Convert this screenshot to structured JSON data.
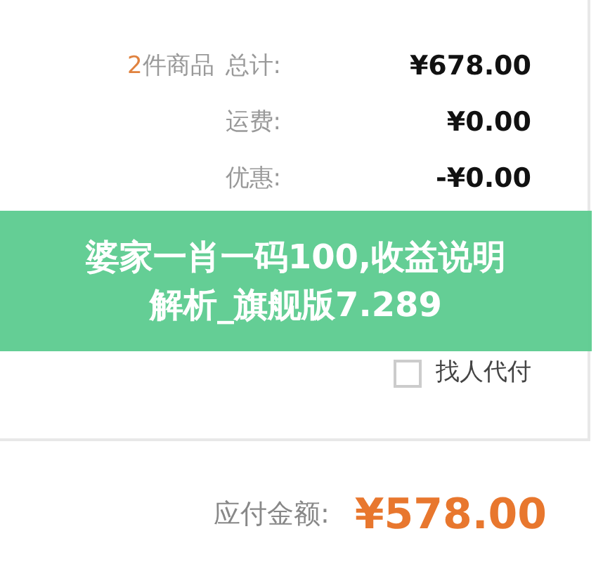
{
  "summary_rows": [
    {
      "count": "2",
      "count_suffix": "件商品",
      "label": "总计:",
      "value": "¥678.00"
    },
    {
      "label": "运费:",
      "value": "¥0.00"
    },
    {
      "label": "优惠:",
      "value": "-¥0.00"
    }
  ],
  "banner": {
    "title": "婆家一肖一码100,收益说明解析_旗舰版7.289"
  },
  "options": [
    {
      "label": "找人代付",
      "checked": false
    }
  ],
  "total": {
    "label": "应付金额:",
    "value": "¥578.00"
  }
}
